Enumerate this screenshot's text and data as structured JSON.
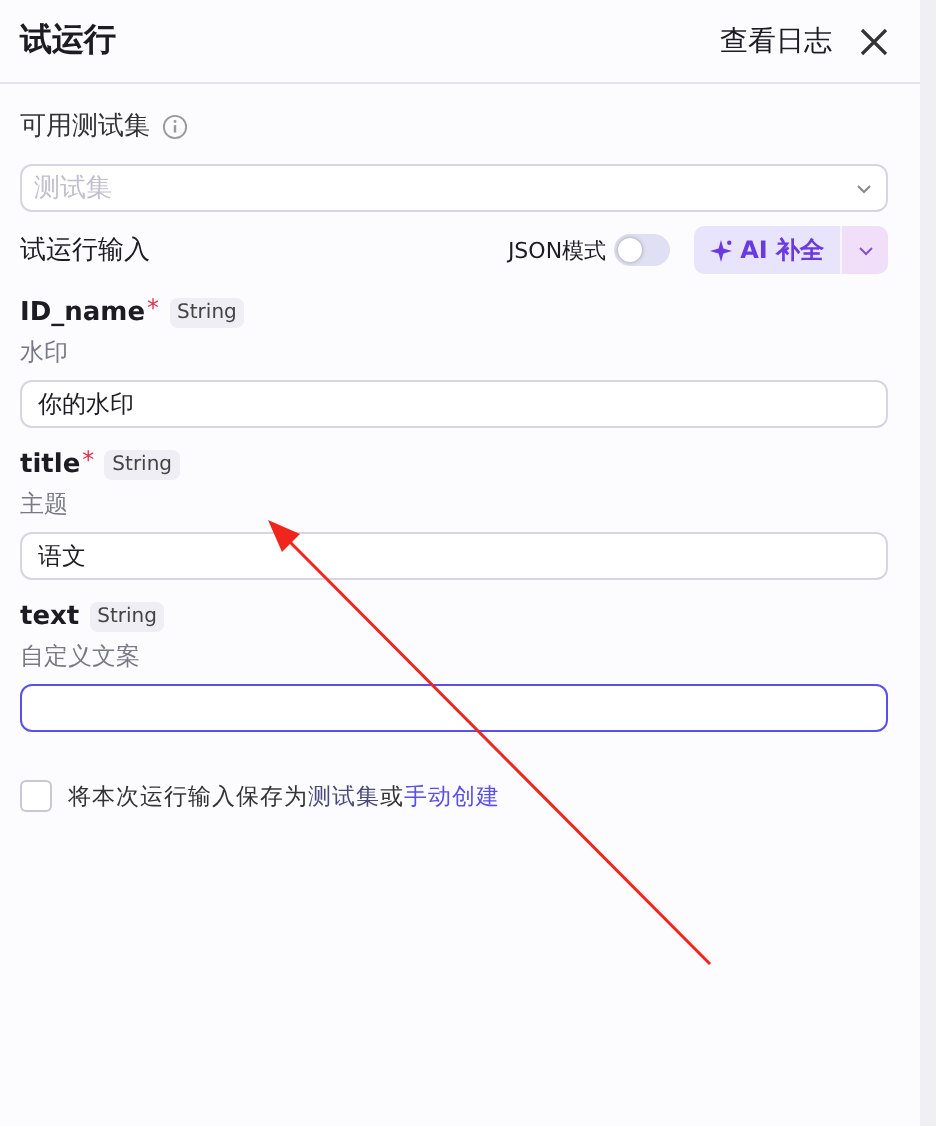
{
  "header": {
    "title": "试运行",
    "log_link": "查看日志"
  },
  "test_set": {
    "label": "可用测试集",
    "placeholder": "测试集"
  },
  "run_input": {
    "label": "试运行输入",
    "json_mode": {
      "label": "JSON模式",
      "on": false
    },
    "ai_button": "AI 补全"
  },
  "fields": [
    {
      "name": "ID_name",
      "required_mark": "*",
      "type": "String",
      "description": "水印",
      "value": "你的水印",
      "focused": false
    },
    {
      "name": "title",
      "required_mark": "*",
      "type": "String",
      "description": "主题",
      "value": "语文",
      "focused": false
    },
    {
      "name": "text",
      "type": "String",
      "description": "自定义文案",
      "focused": true
    }
  ],
  "save_option": {
    "checked": false,
    "text": "将本次运行输入保存为",
    "link_1": "测试集",
    "joiner": "或",
    "link_2": "手动创建"
  }
}
